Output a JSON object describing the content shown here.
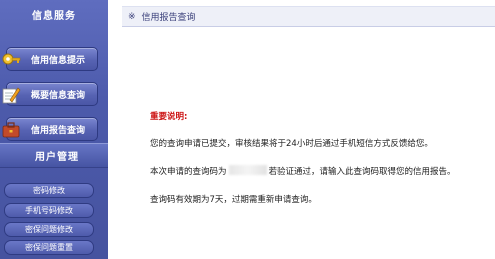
{
  "sidebar": {
    "info_section": {
      "title": "信息服务",
      "items": [
        {
          "label": "信用信息提示",
          "icon": "key-icon"
        },
        {
          "label": "概要信息查询",
          "icon": "pencil-icon"
        },
        {
          "label": "信用报告查询",
          "icon": "briefcase-icon"
        }
      ]
    },
    "user_section": {
      "title": "用户管理",
      "items": [
        {
          "label": "密码修改"
        },
        {
          "label": "手机号码修改"
        },
        {
          "label": "密保问题修改"
        },
        {
          "label": "密保问题重置"
        }
      ]
    }
  },
  "main": {
    "title_mark": "※",
    "title": "信用报告查询",
    "notice_heading": "重要说明:",
    "line1": "您的查询申请已提交，审核结果将于24小时后通过手机短信方式反馈给您。",
    "line2_prefix": "本次申请的查询码为",
    "line2_suffix": "若验证通过，请输入此查询码取得您的信用报告。",
    "line3": "查询码有效期为7天，过期需重新申请查询。"
  },
  "colors": {
    "sidebar_bg": "#4c5aab",
    "notice_red": "#cc1111",
    "header_bg": "#eef0f8"
  }
}
